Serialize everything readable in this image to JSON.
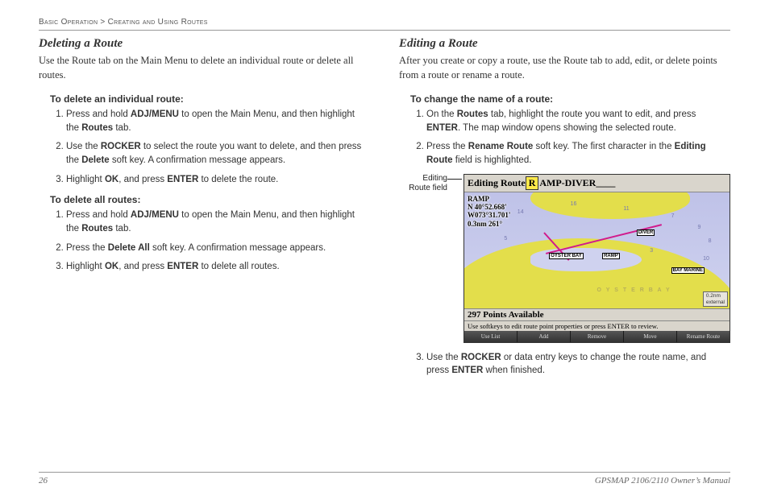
{
  "breadcrumb": {
    "section": "Basic Operation",
    "sep": " > ",
    "sub": "Creating and Using Routes"
  },
  "left": {
    "heading": "Deleting a Route",
    "intro": "Use the Route tab on the Main Menu to delete an individual route or delete all routes.",
    "procA": {
      "title": "To delete an individual route:",
      "steps": [
        {
          "pre": "Press and hold ",
          "b1": "ADJ/MENU",
          "mid": " to open the Main Menu, and then highlight the ",
          "b2": "Routes",
          "post": " tab."
        },
        {
          "pre": "Use the ",
          "b1": "ROCKER",
          "mid": " to select the route you want to delete, and then press the ",
          "b2": "Delete",
          "post": " soft key. A confirmation message appears."
        },
        {
          "pre": "Highlight ",
          "b1": "OK",
          "mid": ", and press ",
          "b2": "ENTER",
          "post": " to delete the route."
        }
      ]
    },
    "procB": {
      "title": "To delete all routes:",
      "steps": [
        {
          "pre": "Press and hold ",
          "b1": "ADJ/MENU",
          "mid": " to open the Main Menu, and then highlight the ",
          "b2": "Routes",
          "post": " tab."
        },
        {
          "pre": "Press the ",
          "b1": "Delete All",
          "mid": " soft key. A confirmation message appears.",
          "b2": "",
          "post": ""
        },
        {
          "pre": "Highlight ",
          "b1": "OK",
          "mid": ", and press ",
          "b2": "ENTER",
          "post": " to delete all routes."
        }
      ]
    }
  },
  "right": {
    "heading": "Editing a Route",
    "intro": "After you create or copy a route, use the Route tab to add, edit, or delete points from a route or rename a route.",
    "procA": {
      "title": "To change the name of a route:",
      "steps_pre": [
        {
          "pre": "On the ",
          "b1": "Routes",
          "mid": " tab, highlight the route you want to edit, and press ",
          "b2": "ENTER",
          "post": ". The map window opens showing the selected route."
        },
        {
          "pre": "Press the ",
          "b1": "Rename Route",
          "mid": " soft key. The first character in the ",
          "b2": "Editing Route",
          "post": " field is highlighted."
        }
      ],
      "steps_post": [
        {
          "pre": "Use the ",
          "b1": "ROCKER",
          "mid": " or data entry keys to change the route name, and press ",
          "b2": "ENTER",
          "post": " when finished."
        }
      ]
    }
  },
  "figure": {
    "callout": "Editing Route field",
    "titlebar": {
      "label": "Editing Route ",
      "cursor": "R",
      "rest": " AMP-DIVER____"
    },
    "info": {
      "l1": "RAMP",
      "l2": "N  40°52.668'",
      "l3": "W073°31.701'",
      "l4": "0.3nm      261°"
    },
    "wpts": {
      "a": "OYSTER BAY",
      "b": "RAMP",
      "c": "DIVER",
      "d": "BAY MARINE"
    },
    "bay": "O Y S T E R B A Y",
    "depths": [
      "14",
      "7",
      "9",
      "8",
      "16",
      "10",
      "11",
      "3",
      "5"
    ],
    "scale": {
      "l1": "0.2nm",
      "l2": "external"
    },
    "status": "297 Points Available",
    "hint": "Use softkeys to edit route point properties or press ENTER to review.",
    "softkeys": [
      "Use List",
      "Add",
      "Remove",
      "Move",
      "Rename Route"
    ]
  },
  "footer": {
    "page": "26",
    "manual": "GPSMAP 2106/2110 Owner’s Manual"
  }
}
